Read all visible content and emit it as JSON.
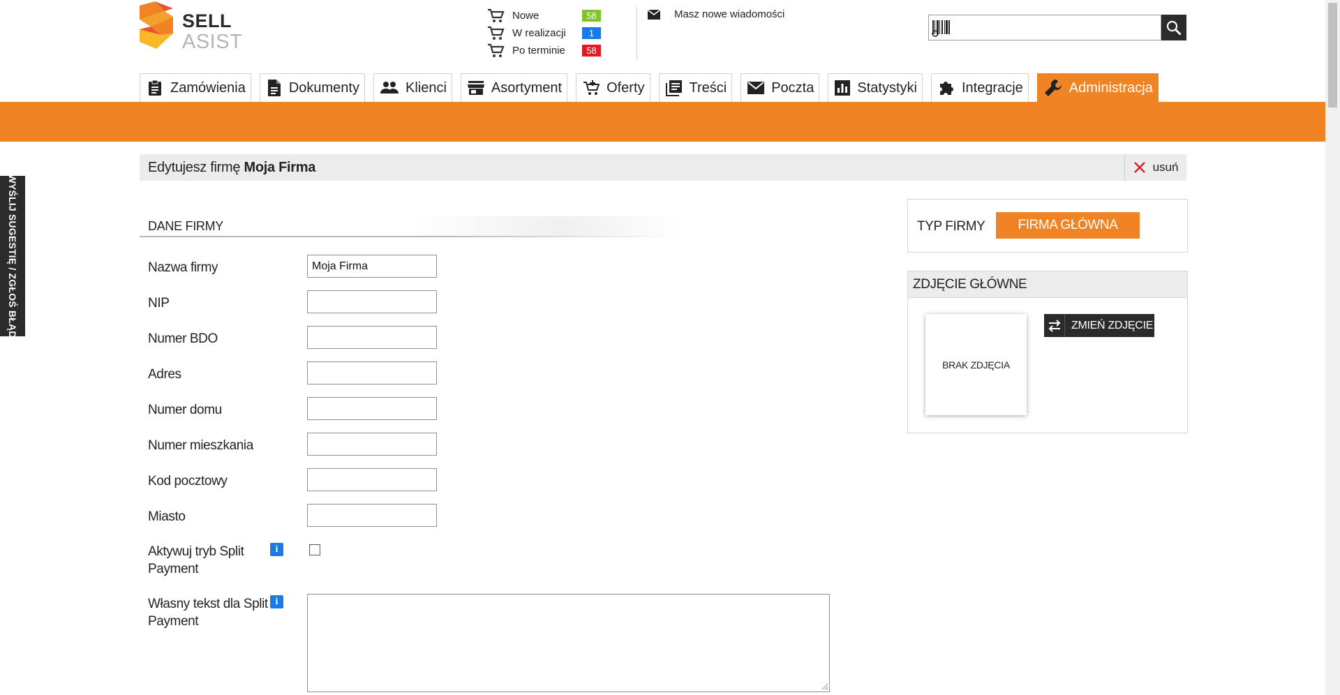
{
  "brand": {
    "line1": "SELL",
    "line2": "ASIST",
    "colors": [
      "#f08324",
      "#f7b928",
      "#e9552a"
    ]
  },
  "order_stats": [
    {
      "label": "Nowe",
      "count": "58",
      "color": "#7cc52a"
    },
    {
      "label": "W realizacji",
      "count": "1",
      "color": "#1a7be6"
    },
    {
      "label": "Po terminie",
      "count": "58",
      "color": "#e01b24"
    }
  ],
  "messages": {
    "label": "Masz nowe wiadomości",
    "icon": "mail-icon"
  },
  "search": {
    "value": "",
    "placeholder": "",
    "icon": "search-icon",
    "barcode_icon": "barcode-icon"
  },
  "nav": {
    "tabs": [
      {
        "label": "Zamówienia",
        "icon": "clipboard-icon",
        "active": false
      },
      {
        "label": "Dokumenty",
        "icon": "document-icon",
        "active": false
      },
      {
        "label": "Klienci",
        "icon": "people-icon",
        "active": false
      },
      {
        "label": "Asortyment",
        "icon": "store-icon",
        "active": false
      },
      {
        "label": "Oferty",
        "icon": "cart-plus-icon",
        "active": false
      },
      {
        "label": "Treści",
        "icon": "content-icon",
        "active": false
      },
      {
        "label": "Poczta",
        "icon": "mail-icon",
        "active": false
      },
      {
        "label": "Statystyki",
        "icon": "chart-icon",
        "active": false
      },
      {
        "label": "Integracje",
        "icon": "puzzle-icon",
        "active": false
      },
      {
        "label": "Administracja",
        "icon": "wrench-icon",
        "active": true
      }
    ],
    "accent": "#f08324"
  },
  "title": {
    "prefix": "Edytujesz firmę",
    "name": "Moja Firma",
    "delete_label": "usuń"
  },
  "side_tab": {
    "label": "WYŚLIJ SUGESTIĘ / ZGŁOŚ BŁĄD"
  },
  "form": {
    "section": "DANE FIRMY",
    "fields": [
      {
        "label": "Nazwa firmy",
        "value": "Moja Firma"
      },
      {
        "label": "NIP",
        "value": ""
      },
      {
        "label": "Numer BDO",
        "value": ""
      },
      {
        "label": "Adres",
        "value": ""
      },
      {
        "label": "Numer domu",
        "value": ""
      },
      {
        "label": "Numer mieszkania",
        "value": ""
      },
      {
        "label": "Kod pocztowy",
        "value": ""
      },
      {
        "label": "Miasto",
        "value": ""
      }
    ],
    "split_payment": {
      "label_1": "Aktywuj tryb Split",
      "label_2": "Payment",
      "checked": false,
      "info": "i"
    },
    "split_text": {
      "label_1": "Własny tekst dla Split",
      "label_2": "Payment",
      "value": "",
      "info": "i"
    }
  },
  "company_type": {
    "label": "TYP FIRMY",
    "value": "FIRMA GŁÓWNA"
  },
  "main_photo": {
    "header": "ZDJĘCIE GŁÓWNE",
    "empty": "BRAK ZDJĘCIA",
    "change_label": "ZMIEŃ ZDJĘCIE"
  }
}
